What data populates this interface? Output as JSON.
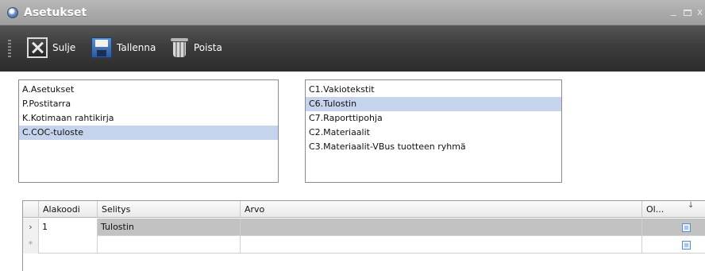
{
  "window": {
    "title": "Asetukset",
    "controls": {
      "minimize": "_",
      "close": "x"
    }
  },
  "toolbar": {
    "close_label": "Sulje",
    "save_label": "Tallenna",
    "delete_label": "Poista"
  },
  "left_list": {
    "items": [
      "A.Asetukset",
      "P.Postitarra",
      "K.Kotimaan rahtikirja",
      "C.COC-tuloste"
    ],
    "selected": "C.COC-tuloste"
  },
  "right_list": {
    "items": [
      "C1.Vakiotekstit",
      "C6.Tulostin",
      "C7.Raporttipohja",
      "C2.Materiaalit",
      "C3.Materiaalit-VBus tuotteen ryhmä"
    ],
    "selected": "C6.Tulostin"
  },
  "grid": {
    "columns": [
      "Alakoodi",
      "Selitys",
      "Arvo",
      "Ol..."
    ],
    "rows": [
      {
        "indicator": "›",
        "alakoodi": "1",
        "selitys": "Tulostin",
        "arvo": ""
      },
      {
        "indicator": "*",
        "alakoodi": "",
        "selitys": "",
        "arvo": ""
      }
    ],
    "sort_icon": "sort-down-icon"
  },
  "colors": {
    "selection": "#c6d3ec",
    "toolbar_bg": "#3c3c3c",
    "titlebar_bg": "#a9a9a9",
    "current_row": "#c2c2c2"
  }
}
